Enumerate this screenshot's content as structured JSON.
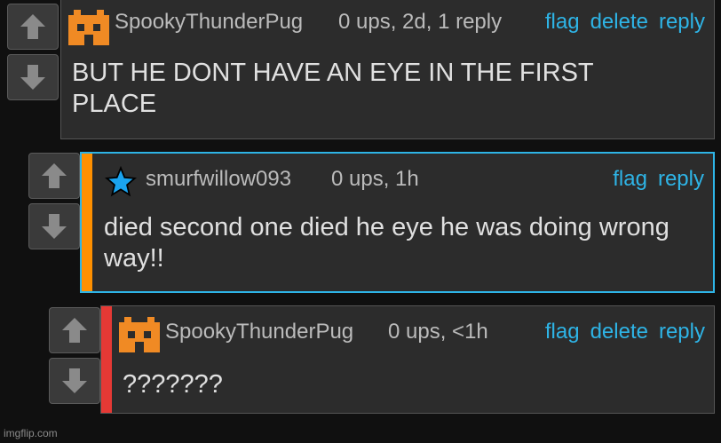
{
  "comments": [
    {
      "username": "SpookyThunderPug",
      "meta": "0 ups, 2d, 1 reply",
      "actions": [
        "flag",
        "delete",
        "reply"
      ],
      "text": "BUT HE DONT HAVE AN EYE IN THE FIRST PLACE",
      "avatar": "pixel-avatar-orange",
      "stripe_color": ""
    },
    {
      "username": "smurfwillow093",
      "meta": "0 ups, 1h",
      "actions": [
        "flag",
        "reply"
      ],
      "text": "died second one died he eye he was doing wrong way!!",
      "avatar": "blue-star",
      "stripe_color": "#ff9000"
    },
    {
      "username": "SpookyThunderPug",
      "meta": "0 ups, <1h",
      "actions": [
        "flag",
        "delete",
        "reply"
      ],
      "text": "???????",
      "avatar": "pixel-avatar-orange",
      "stripe_color": "#e53935"
    }
  ],
  "colors": {
    "accent": "#2eb4e6",
    "focus_border": "#2eb4e6",
    "orange": "#ff9000",
    "red": "#e53935"
  },
  "icons": {
    "upvote": "up-arrow-icon",
    "downvote": "down-arrow-icon"
  },
  "watermark": "imgflip.com"
}
